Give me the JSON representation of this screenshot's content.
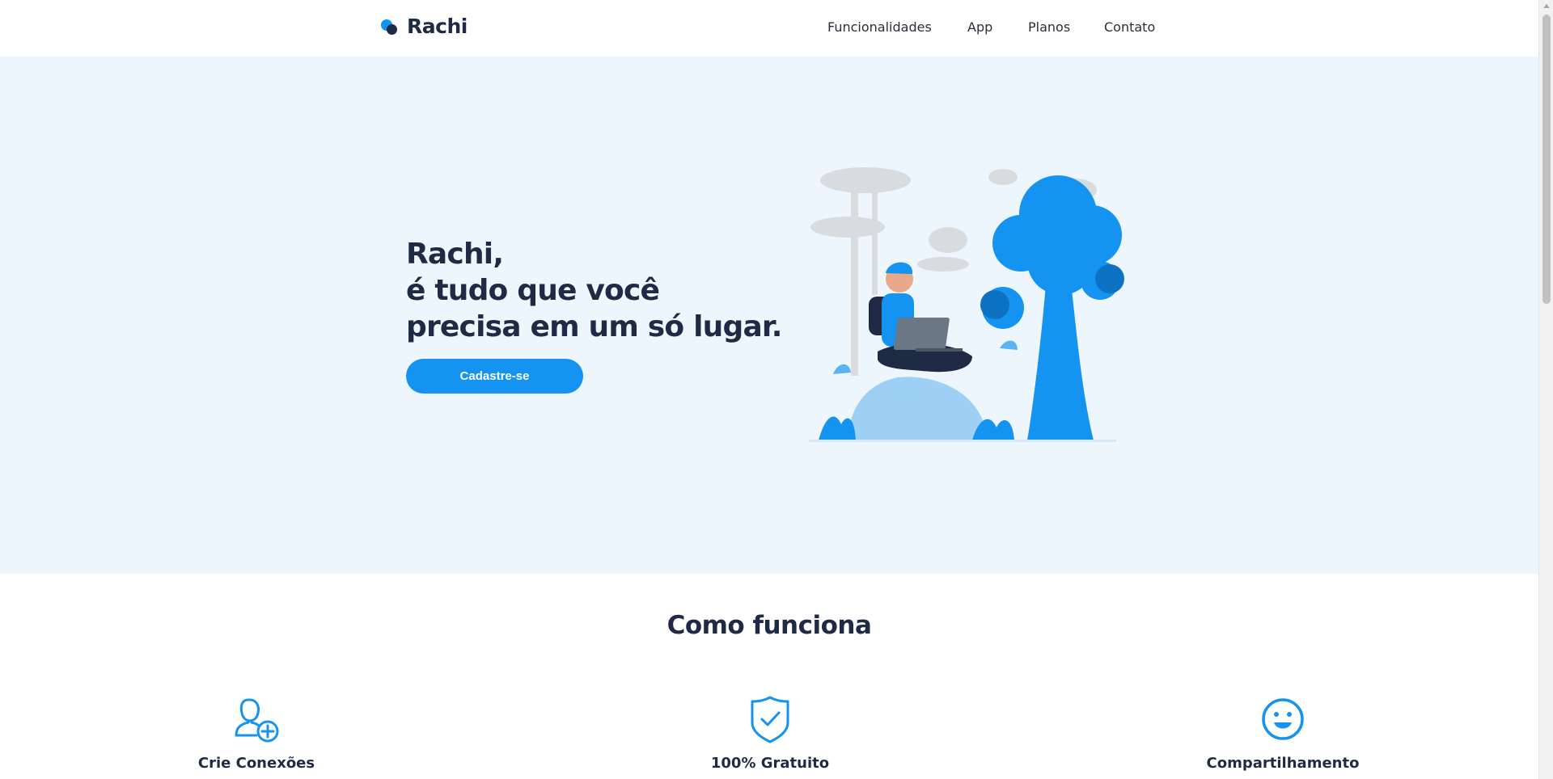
{
  "brand": {
    "name": "Rachi"
  },
  "nav": {
    "items": [
      {
        "label": "Funcionalidades"
      },
      {
        "label": "App"
      },
      {
        "label": "Planos"
      },
      {
        "label": "Contato"
      }
    ]
  },
  "hero": {
    "title_lines": [
      "Rachi,",
      "é tudo que você",
      "precisa em um só lugar."
    ],
    "cta_label": "Cadastre-se"
  },
  "how_it_works": {
    "title": "Como funciona",
    "features": [
      {
        "label": "Crie Conexões",
        "icon": "add-user-icon"
      },
      {
        "label": "100% Gratuito",
        "icon": "shield-check-icon"
      },
      {
        "label": "Compartilhamento",
        "icon": "smiley-icon"
      }
    ]
  },
  "colors": {
    "accent": "#1493f0",
    "dark": "#1f2a44",
    "hero_bg": "#eef6fd"
  }
}
